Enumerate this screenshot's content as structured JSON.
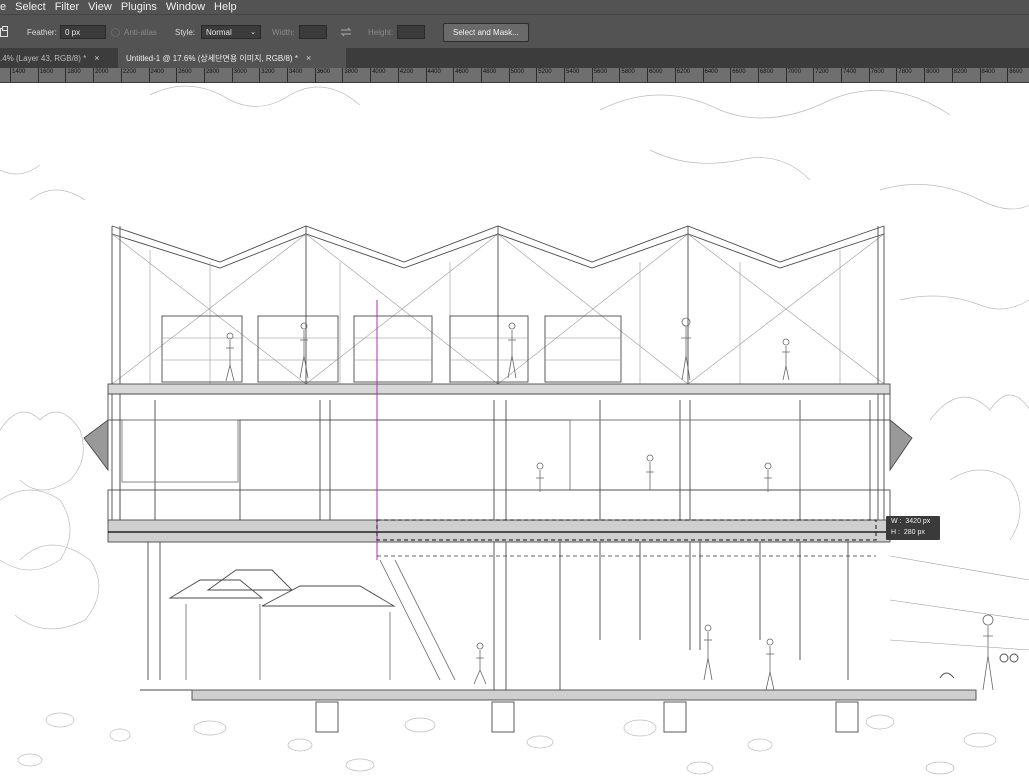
{
  "menu": {
    "items": [
      "e",
      "Select",
      "Filter",
      "View",
      "Plugins",
      "Window",
      "Help"
    ]
  },
  "options": {
    "feather_label": "Feather:",
    "feather_value": "0 px",
    "antialias_label": "Anti-alias",
    "style_label": "Style:",
    "style_value": "Normal",
    "width_label": "Width:",
    "height_label": "Height:",
    "select_mask_label": "Select and Mask..."
  },
  "tabs": [
    {
      "label": ".4% (Layer 43, RGB/8) *",
      "close": "×"
    },
    {
      "label": "Untitled-1 @ 17.6% (상세단면용 이미지, RGB/8) *",
      "close": "×"
    }
  ],
  "ruler": {
    "labels": [
      "1400",
      "1600",
      "1800",
      "2000",
      "2200",
      "2400",
      "2600",
      "2800",
      "3000",
      "3200",
      "3400",
      "3600",
      "3800",
      "4000",
      "4200",
      "4400",
      "4600",
      "4800",
      "5000",
      "5200",
      "5400",
      "5600",
      "5800",
      "6000",
      "6200",
      "6400",
      "6600",
      "6800",
      "7000",
      "7200",
      "7400",
      "7600",
      "7800",
      "8000",
      "8200",
      "8400",
      "8600"
    ]
  },
  "measure": {
    "w_label": "W :",
    "w_value": "3420 px",
    "h_label": "H :",
    "h_value": "280 px"
  },
  "colors": {
    "chrome": "#535353",
    "tabbar": "#3c3c3c",
    "ruler": "#6f6f6f",
    "guide": "#b030b0"
  },
  "icons": {
    "swap": "swap-arrows-icon",
    "tool": "marquee-tool-icon"
  }
}
